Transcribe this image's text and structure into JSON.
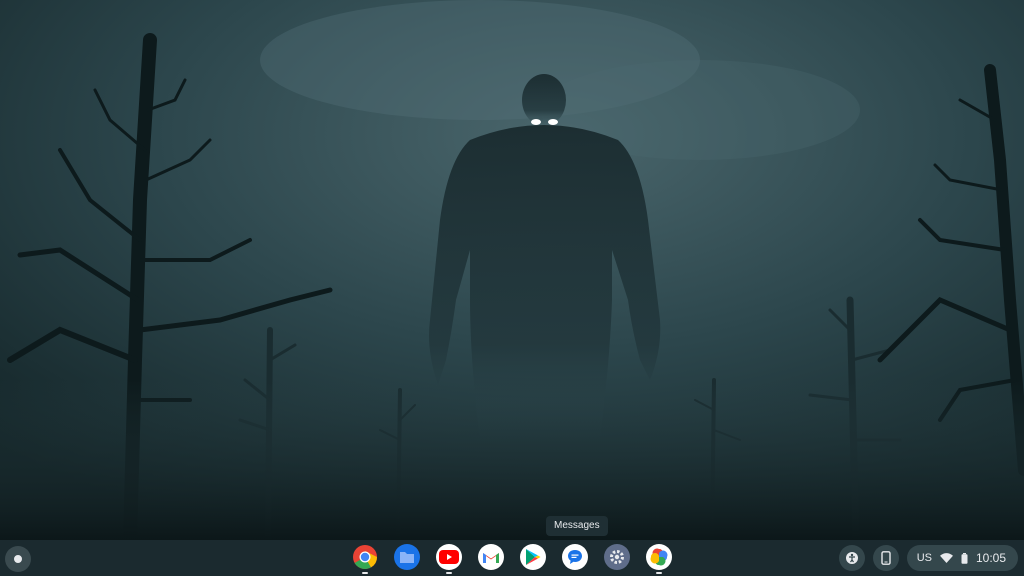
{
  "tooltip": {
    "text": "Messages"
  },
  "shelf": {
    "apps": [
      {
        "name": "Chrome",
        "icon": "chrome-icon",
        "running": true
      },
      {
        "name": "Files",
        "icon": "files-icon",
        "running": false
      },
      {
        "name": "YouTube",
        "icon": "youtube-icon",
        "running": true
      },
      {
        "name": "Gmail",
        "icon": "gmail-icon",
        "running": false
      },
      {
        "name": "Play Store",
        "icon": "play-store-icon",
        "running": false
      },
      {
        "name": "Messages",
        "icon": "messages-icon",
        "running": false
      },
      {
        "name": "Settings",
        "icon": "settings-icon",
        "running": false
      },
      {
        "name": "Photos",
        "icon": "photos-icon",
        "running": true
      }
    ]
  },
  "tray": {
    "keyboard_layout": "US",
    "time": "10:05"
  },
  "colors": {
    "shelf_bg": "#1b2a2f",
    "wallpaper_fog": "#3c5a60"
  }
}
